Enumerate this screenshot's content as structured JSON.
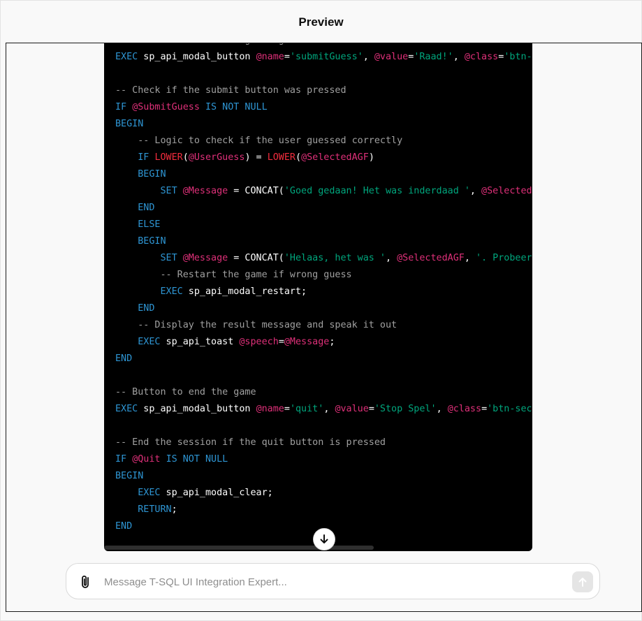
{
  "header": {
    "title": "Preview"
  },
  "code": {
    "lines": [
      [
        [
          "cm",
          "-- Button for submitting the guess"
        ]
      ],
      [
        [
          "kw",
          "EXEC"
        ],
        [
          "pl",
          " sp_api_modal_button "
        ],
        [
          "var",
          "@name"
        ],
        [
          "pl",
          "="
        ],
        [
          "str",
          "'submitGuess'"
        ],
        [
          "pl",
          ", "
        ],
        [
          "var",
          "@value"
        ],
        [
          "pl",
          "="
        ],
        [
          "str",
          "'Raad!'"
        ],
        [
          "pl",
          ", "
        ],
        [
          "var",
          "@class"
        ],
        [
          "pl",
          "="
        ],
        [
          "str",
          "'btn-primary'"
        ],
        [
          "pl",
          ";"
        ]
      ],
      [],
      [
        [
          "cm",
          "-- Check if the submit button was pressed"
        ]
      ],
      [
        [
          "kw",
          "IF"
        ],
        [
          "pl",
          " "
        ],
        [
          "var",
          "@SubmitGuess"
        ],
        [
          "pl",
          " "
        ],
        [
          "kw",
          "IS NOT NULL"
        ]
      ],
      [
        [
          "kw",
          "BEGIN"
        ]
      ],
      [
        [
          "pl",
          "    "
        ],
        [
          "cm",
          "-- Logic to check if the user guessed correctly"
        ]
      ],
      [
        [
          "pl",
          "    "
        ],
        [
          "kw",
          "IF"
        ],
        [
          "pl",
          " "
        ],
        [
          "fn",
          "LOWER"
        ],
        [
          "pl",
          "("
        ],
        [
          "var",
          "@UserGuess"
        ],
        [
          "pl",
          ") = "
        ],
        [
          "fn",
          "LOWER"
        ],
        [
          "pl",
          "("
        ],
        [
          "var",
          "@SelectedAGF"
        ],
        [
          "pl",
          ")"
        ]
      ],
      [
        [
          "pl",
          "    "
        ],
        [
          "kw",
          "BEGIN"
        ]
      ],
      [
        [
          "pl",
          "        "
        ],
        [
          "kw",
          "SET"
        ],
        [
          "pl",
          " "
        ],
        [
          "var",
          "@Message"
        ],
        [
          "pl",
          " = CONCAT("
        ],
        [
          "str",
          "'Goed gedaan! Het was inderdaad '"
        ],
        [
          "pl",
          ", "
        ],
        [
          "var",
          "@SelectedAGF"
        ],
        [
          "pl",
          ");"
        ]
      ],
      [
        [
          "pl",
          "    "
        ],
        [
          "kw",
          "END"
        ]
      ],
      [
        [
          "pl",
          "    "
        ],
        [
          "kw",
          "ELSE"
        ]
      ],
      [
        [
          "pl",
          "    "
        ],
        [
          "kw",
          "BEGIN"
        ]
      ],
      [
        [
          "pl",
          "        "
        ],
        [
          "kw",
          "SET"
        ],
        [
          "pl",
          " "
        ],
        [
          "var",
          "@Message"
        ],
        [
          "pl",
          " = CONCAT("
        ],
        [
          "str",
          "'Helaas, het was '"
        ],
        [
          "pl",
          ", "
        ],
        [
          "var",
          "@SelectedAGF"
        ],
        [
          "pl",
          ", "
        ],
        [
          "str",
          "'. Probeer het opnieuw!'"
        ],
        [
          "pl",
          ");"
        ]
      ],
      [
        [
          "pl",
          "        "
        ],
        [
          "cm",
          "-- Restart the game if wrong guess"
        ]
      ],
      [
        [
          "pl",
          "        "
        ],
        [
          "kw",
          "EXEC"
        ],
        [
          "pl",
          " sp_api_modal_restart;"
        ]
      ],
      [
        [
          "pl",
          "    "
        ],
        [
          "kw",
          "END"
        ]
      ],
      [
        [
          "pl",
          "    "
        ],
        [
          "cm",
          "-- Display the result message and speak it out"
        ]
      ],
      [
        [
          "pl",
          "    "
        ],
        [
          "kw",
          "EXEC"
        ],
        [
          "pl",
          " sp_api_toast "
        ],
        [
          "var",
          "@speech"
        ],
        [
          "pl",
          "="
        ],
        [
          "var",
          "@Message"
        ],
        [
          "pl",
          ";"
        ]
      ],
      [
        [
          "kw",
          "END"
        ]
      ],
      [],
      [
        [
          "cm",
          "-- Button to end the game"
        ]
      ],
      [
        [
          "kw",
          "EXEC"
        ],
        [
          "pl",
          " sp_api_modal_button "
        ],
        [
          "var",
          "@name"
        ],
        [
          "pl",
          "="
        ],
        [
          "str",
          "'quit'"
        ],
        [
          "pl",
          ", "
        ],
        [
          "var",
          "@value"
        ],
        [
          "pl",
          "="
        ],
        [
          "str",
          "'Stop Spel'"
        ],
        [
          "pl",
          ", "
        ],
        [
          "var",
          "@class"
        ],
        [
          "pl",
          "="
        ],
        [
          "str",
          "'btn-secondary'"
        ],
        [
          "pl",
          ";"
        ]
      ],
      [],
      [
        [
          "cm",
          "-- End the session if the quit button is pressed"
        ]
      ],
      [
        [
          "kw",
          "IF"
        ],
        [
          "pl",
          " "
        ],
        [
          "var",
          "@Quit"
        ],
        [
          "pl",
          " "
        ],
        [
          "kw",
          "IS NOT NULL"
        ]
      ],
      [
        [
          "kw",
          "BEGIN"
        ]
      ],
      [
        [
          "pl",
          "    "
        ],
        [
          "kw",
          "EXEC"
        ],
        [
          "pl",
          " sp_api_modal_clear;"
        ]
      ],
      [
        [
          "pl",
          "    "
        ],
        [
          "kw",
          "RETURN"
        ],
        [
          "pl",
          ";"
        ]
      ],
      [
        [
          "kw",
          "END"
        ]
      ]
    ]
  },
  "composer": {
    "placeholder": "Message T-SQL UI Integration Expert...",
    "value": ""
  },
  "icons": {
    "attach": "paperclip-icon",
    "send": "arrow-up-icon",
    "scroll_down": "arrow-down-icon"
  },
  "colors": {
    "keyword": "#2e95d3",
    "variable": "#df3079",
    "string": "#00a67d",
    "function": "#f22c3d",
    "comment": "#a0a0a0",
    "code_background": "#000000"
  }
}
